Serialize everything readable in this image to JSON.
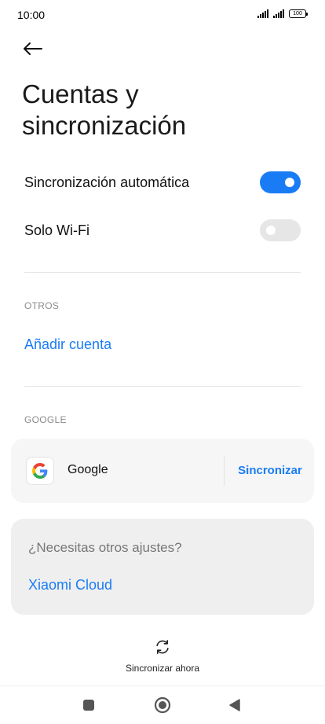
{
  "status_bar": {
    "time": "10:00",
    "battery": "100"
  },
  "header": {
    "title_line1": "Cuentas y",
    "title_line2": "sincronización"
  },
  "settings": {
    "auto_sync": {
      "label": "Sincronización automática",
      "enabled": true
    },
    "wifi_only": {
      "label": "Solo Wi-Fi",
      "enabled": false
    }
  },
  "others": {
    "header": "OTROS",
    "add_account": "Añadir cuenta"
  },
  "google": {
    "header": "GOOGLE",
    "account_name": "Google",
    "sync_label": "Sincronizar"
  },
  "more_settings": {
    "question": "¿Necesitas otros ajustes?",
    "link": "Xiaomi Cloud"
  },
  "footer": {
    "sync_now": "Sincronizar ahora"
  },
  "colors": {
    "accent": "#1a7cf5",
    "toggle_off": "#e6e6e6"
  }
}
